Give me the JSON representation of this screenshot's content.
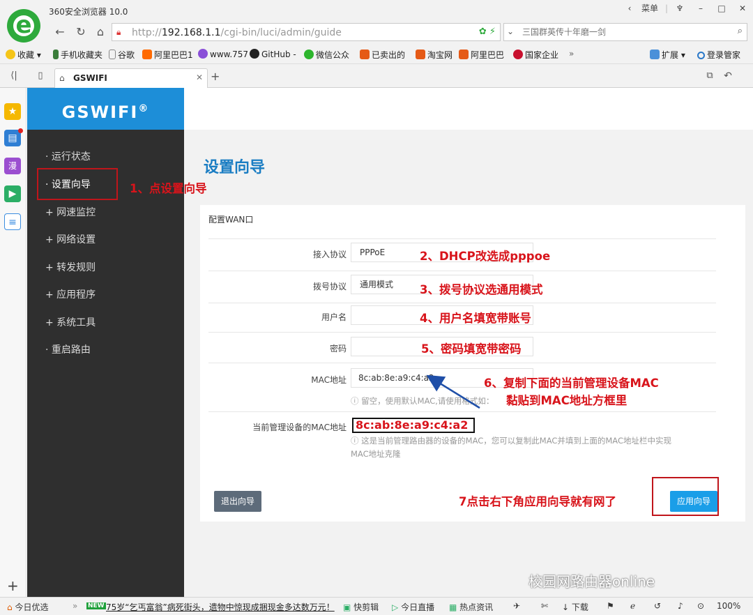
{
  "browser": {
    "app_title": "360安全浏览器 10.0",
    "menu_label": "菜单",
    "url_prefix": "http://",
    "url_host": "192.168.1.1",
    "url_path": "/cgi-bin/luci/admin/guide",
    "search_placeholder": "三国群英传十年磨一剑",
    "bookmarks": [
      "收藏",
      "手机收藏夹",
      "谷歌",
      "阿里巴巴1",
      "www.757",
      "GitHub -",
      "微信公众",
      "已卖出的",
      "淘宝网",
      "阿里巴巴",
      "国家企业",
      "扩展",
      "登录管家"
    ],
    "tab_title": "GSWIFI"
  },
  "router": {
    "brand": "GSWIFI",
    "brand_mark": "®",
    "menu": [
      "· 运行状态",
      "· 设置向导",
      "+ 网速监控",
      "+ 网络设置",
      "+ 转发规则",
      "+ 应用程序",
      "+ 系统工具",
      "· 重启路由"
    ],
    "page_title": "设置向导",
    "panel_title": "配置WAN口",
    "fields": {
      "protocol_label": "接入协议",
      "protocol_value": "PPPoE",
      "dial_label": "拨号协议",
      "dial_value": "通用模式",
      "username_label": "用户名",
      "password_label": "密码",
      "mac_label": "MAC地址",
      "mac_value": "8c:ab:8e:a9:c4:a2",
      "mac_hint": "留空，使用默认MAC,请使用格式如：",
      "current_mac_label": "当前管理设备的MAC地址",
      "current_mac_value": "8c:ab:8e:a9:c4:a2",
      "current_mac_hint_1": "这是当前管理路由器的设备的MAC，您可以复制此MAC并填到上面的MAC地址栏中实现",
      "current_mac_hint_2": "MAC地址克隆"
    },
    "exit_button": "退出向导",
    "apply_button": "应用向导"
  },
  "annotations": {
    "step1": "1、点设置向导",
    "step2": "2、DHCP改选成pppoe",
    "step3": "3、拨号协议选通用模式",
    "step4": "4、用户名填宽带账号",
    "step5": "5、密码填宽带密码",
    "step6a": "6、复制下面的当前管理设备MAC",
    "step6b": "黏贴到MAC地址方框里",
    "step7": "7点击右下角应用向导就有网了"
  },
  "statusbar": {
    "today": "今日优选",
    "new_badge": "NEW",
    "news": "75岁“乞丐富翁”病死街头，遗物中惊现成捆现金多达数万元！",
    "quick_cut": "快剪辑",
    "live": "今日直播",
    "hot": "热点资讯",
    "download": "下载",
    "zoom": "100%"
  },
  "watermark": "校园网路由器online",
  "colors": {
    "brand_blue": "#1d8ed8",
    "title_blue": "#1a7dc3",
    "menu_dark": "#2f2f2f",
    "annotation_red": "#d8141b",
    "apply_blue": "#1a9ee8",
    "exit_gray": "#5d6b7a"
  }
}
